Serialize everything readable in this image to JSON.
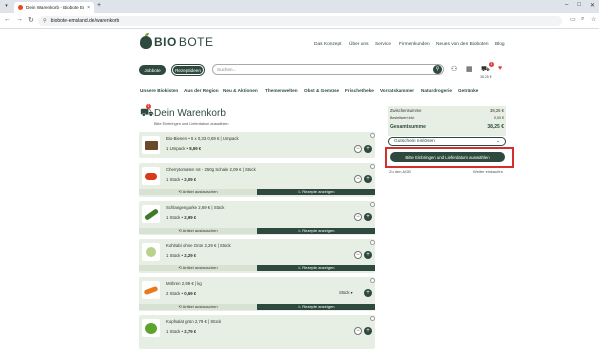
{
  "browser": {
    "tab_title": "Dein Warenkorb - Biobote Ems",
    "url": "biobote-emsland.de/warenkorb",
    "new_tab": "+",
    "close": "×"
  },
  "header": {
    "logo_bio": "BIO",
    "logo_bote": "BOTE",
    "nav": [
      "Das Konzept",
      "Über uns",
      "Service",
      "Firmenkunden",
      "Neues von den Bioboten",
      "Blog"
    ],
    "jobs_label": "Jobbote",
    "recipes_label": "Rezeptideen",
    "search_placeholder": "Suchen...",
    "cart_count": "1",
    "cart_total": "38,25 €"
  },
  "categories": [
    "Unsere Biokisten",
    "Aus der Region",
    "Neu & Aktionen",
    "Themenwelten",
    "Obst & Gemüse",
    "Frischetheke",
    "Vorratskammer",
    "Naturdrogerie",
    "Getränke"
  ],
  "cart": {
    "title": "Dein Warenkorb",
    "cart_badge": "1",
    "subtitle": "Bitte Einbringen und Lieferdatum auswählen",
    "items": [
      {
        "name": "Bio-Bienen • 6 x 0,33 0,69 € | Umpack",
        "qty": "1 Umpack • ",
        "price": "8,69 €",
        "color": "#6b4a2a",
        "actions": false
      },
      {
        "name": "Cherrytomaten rot - 250g Schale 2,09 € | Stück",
        "qty": "1 Stück • ",
        "price": "2,09 €",
        "color": "#d83a1a",
        "actions": true
      },
      {
        "name": "Schlangengurke 2,69 € | Stück",
        "qty": "1 Stück • ",
        "price": "2,99 €",
        "color": "#3f7a2a",
        "actions": true
      },
      {
        "name": "Kohlrabi ohne Grün 2,29 € | Stück",
        "qty": "1 Stück • ",
        "price": "2,29 €",
        "color": "#b7d28a",
        "actions": true
      },
      {
        "name": "Möhren 2,99 € | kg",
        "qty": "2 Stück • ",
        "price": "0,69 €",
        "color": "#ea7a1e",
        "actions": true,
        "unit": "Stück ▾"
      },
      {
        "name": "Kopfsalat grün 2,79 € | Stück",
        "qty": "1 Stück • ",
        "price": "2,79 €",
        "color": "#5ea32e",
        "actions": false
      }
    ],
    "remove_label": "Artikel austauschen",
    "recipes_label": "Rezepte anzeigen"
  },
  "summary": {
    "zwischen_label": "Zwischensumme",
    "zwischen_value": "38,25 €",
    "pfand_label": "Bestellwert inkl.",
    "pfand_value": "0,00 €",
    "total_label": "Gesamtsumme",
    "total_value": "38,25 €",
    "voucher_label": "Gutschein einlösen",
    "cta_label": "Bitte Einbringen und Lieferdatum auswählen",
    "agb_link": "Zu den AGB",
    "continue_link": "Weiter einkaufen"
  }
}
